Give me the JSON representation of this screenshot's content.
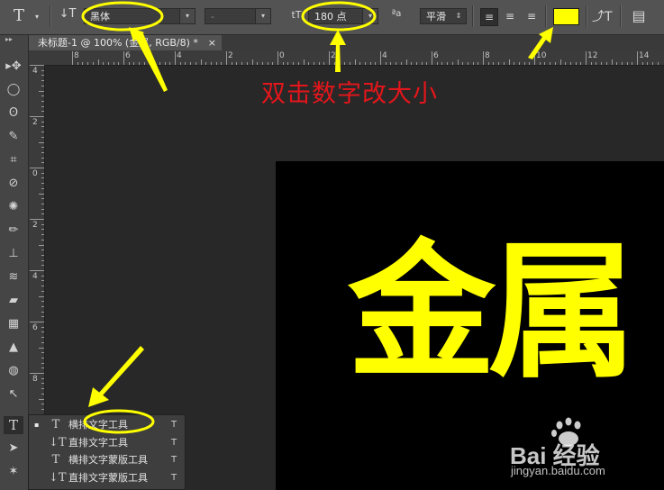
{
  "options_bar": {
    "tool_glyph": "T",
    "orient_glyph": "↓T",
    "font_family": "黑体",
    "font_style": "-",
    "size_glyph": "tT",
    "font_size": "180 点",
    "aa_glyph": "ªa",
    "antialias": "平滑",
    "align_icons": [
      "align-left-icon",
      "align-center-icon",
      "align-right-icon"
    ],
    "text_color": "#ffff00",
    "warp_glyph": "⤴T",
    "panel_glyph": "▤"
  },
  "document_tab": {
    "title": "未标题-1 @ 100% (金属, RGB/8) *",
    "close": "×"
  },
  "rulers": {
    "horizontal_labels": [
      "8",
      "6",
      "4",
      "2",
      "0",
      "2",
      "4",
      "6",
      "8",
      "10",
      "12",
      "14"
    ],
    "vertical_labels": [
      "4",
      "2",
      "0",
      "2",
      "4",
      "6",
      "8"
    ]
  },
  "canvas": {
    "text": "金属",
    "text_color": "#ffff00",
    "background": "#000000"
  },
  "annotation": {
    "text": "双击数字改大小",
    "color": "#e4161b",
    "highlight_color": "#ffff00"
  },
  "flyout_menu": {
    "items": [
      {
        "icon": "T",
        "label": "横排文字工具",
        "shortcut": "T",
        "selected": "▪"
      },
      {
        "icon": "↓T",
        "label": "直排文字工具",
        "shortcut": "T",
        "selected": ""
      },
      {
        "icon": "T",
        "label": "横排文字蒙版工具",
        "shortcut": "T",
        "selected": ""
      },
      {
        "icon": "↓T",
        "label": "直排文字蒙版工具",
        "shortcut": "T",
        "selected": ""
      }
    ]
  },
  "toolbar": {
    "tools": [
      "move-tool-icon",
      "marquee-tool-icon",
      "lasso-tool-icon",
      "quick-select-tool-icon",
      "crop-tool-icon",
      "eyedropper-tool-icon",
      "healing-brush-tool-icon",
      "brush-tool-icon",
      "clone-stamp-tool-icon",
      "history-brush-tool-icon",
      "eraser-tool-icon",
      "gradient-tool-icon",
      "blur-tool-icon",
      "dodge-tool-icon",
      "pen-tool-icon",
      "type-tool-icon",
      "path-select-tool-icon",
      "custom-shape-tool-icon"
    ],
    "glyphs": [
      "▸✥",
      "◯",
      "ʘ",
      "✎",
      "⌗",
      "⊘",
      "✺",
      "✏",
      "⊥",
      "≋",
      "▰",
      "▦",
      "▲",
      "◍",
      "↖",
      "T",
      "➤",
      "✶"
    ]
  },
  "watermark": {
    "logo": "Bai 经验",
    "url": "jingyan.baidu.com"
  }
}
